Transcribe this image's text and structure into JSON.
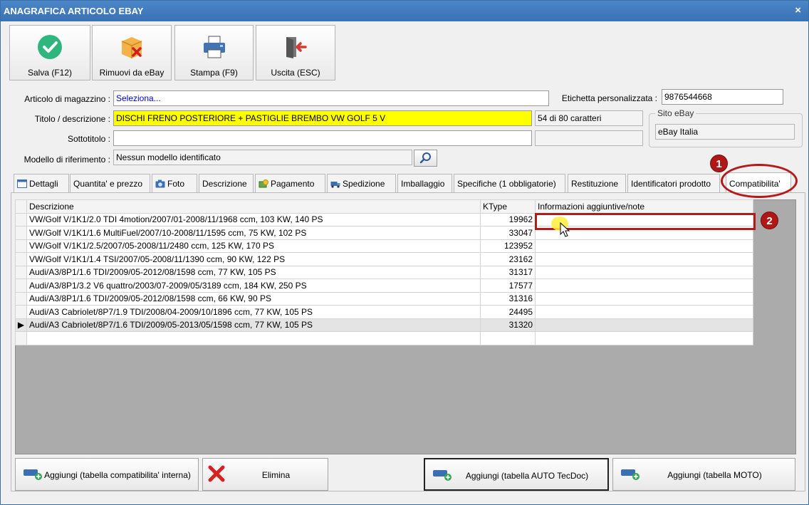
{
  "window": {
    "title": "ANAGRAFICA ARTICOLO EBAY",
    "close_glyph": "×"
  },
  "toolbar": [
    {
      "label": "Salva (F12)",
      "icon": "check-icon",
      "color": "#2eb67d"
    },
    {
      "label": "Rimuovi da eBay",
      "icon": "box-remove-icon",
      "color": "#f2a93b"
    },
    {
      "label": "Stampa (F9)",
      "icon": "printer-icon",
      "color": "#3b6fb0"
    },
    {
      "label": "Uscita (ESC)",
      "icon": "exit-icon",
      "color": "#cc3333"
    }
  ],
  "form": {
    "articolo_label": "Articolo di magazzino :",
    "articolo_value": "Seleziona...",
    "etichetta_label": "Etichetta personalizzata :",
    "etichetta_value": "9876544668",
    "titolo_label": "Titolo / descrizione :",
    "titolo_value": "DISCHI FRENO POSTERIORE + PASTIGLIE BREMBO VW GOLF 5 V",
    "titolo_count": "54 di 80 caratteri",
    "sottotitolo_label": "Sottotitolo :",
    "sottotitolo_value": "",
    "modello_label": "Modello di riferimento :",
    "modello_value": "Nessun modello identificato",
    "sito_title": "Sito eBay",
    "sito_value": "eBay Italia"
  },
  "tabs": [
    {
      "label": "Dettagli",
      "icon": "table-icon"
    },
    {
      "label": "Quantita' e prezzo",
      "icon": ""
    },
    {
      "label": "Foto",
      "icon": "camera-icon"
    },
    {
      "label": "Descrizione",
      "icon": ""
    },
    {
      "label": "Pagamento",
      "icon": "money-icon"
    },
    {
      "label": "Spedizione",
      "icon": "truck-icon"
    },
    {
      "label": "Imballaggio",
      "icon": ""
    },
    {
      "label": "Specifiche (1 obbligatorie)",
      "icon": ""
    },
    {
      "label": "Restituzione",
      "icon": ""
    },
    {
      "label": "Identificatori prodotto",
      "icon": ""
    },
    {
      "label": "Compatibilita'",
      "icon": "",
      "active": true
    }
  ],
  "grid": {
    "columns": [
      "Descrizione",
      "KType",
      "Informazioni aggiuntive/note"
    ],
    "rows": [
      {
        "descrizione": "VW/Golf V/1K1/2.0 TDI 4motion/2007/01-2008/11/1968 ccm, 103 KW, 140 PS",
        "ktype": "19962",
        "note": ""
      },
      {
        "descrizione": "VW/Golf V/1K1/1.6 MultiFuel/2007/10-2008/11/1595 ccm, 75 KW, 102 PS",
        "ktype": "33047",
        "note": ""
      },
      {
        "descrizione": "VW/Golf V/1K1/2.5/2007/05-2008/11/2480 ccm, 125 KW, 170 PS",
        "ktype": "123952",
        "note": ""
      },
      {
        "descrizione": "VW/Golf V/1K1/1.4 TSI/2007/05-2008/11/1390 ccm, 90 KW, 122 PS",
        "ktype": "23162",
        "note": ""
      },
      {
        "descrizione": "Audi/A3/8P1/1.6 TDI/2009/05-2012/08/1598 ccm, 77 KW, 105 PS",
        "ktype": "31317",
        "note": ""
      },
      {
        "descrizione": "Audi/A3/8P1/3.2 V6 quattro/2003/07-2009/05/3189 ccm, 184 KW, 250 PS",
        "ktype": "17577",
        "note": ""
      },
      {
        "descrizione": "Audi/A3/8P1/1.6 TDI/2009/05-2012/08/1598 ccm, 66 KW, 90 PS",
        "ktype": "31316",
        "note": ""
      },
      {
        "descrizione": "Audi/A3 Cabriolet/8P7/1.9 TDI/2008/04-2009/10/1896 ccm, 77 KW, 105 PS",
        "ktype": "24495",
        "note": ""
      },
      {
        "descrizione": "Audi/A3 Cabriolet/8P7/1.6 TDI/2009/05-2013/05/1598 ccm, 77 KW, 105 PS",
        "ktype": "31320",
        "note": "",
        "current": true
      }
    ],
    "row_marker": "▶"
  },
  "bottom_buttons": [
    {
      "label": "Aggiungi (tabella compatibilita' interna)",
      "icon": "car-add-icon"
    },
    {
      "label": "Elimina",
      "icon": "delete-x-icon"
    },
    {
      "label": "Aggiungi (tabella AUTO TecDoc)",
      "icon": "car-add-icon",
      "focused": true
    },
    {
      "label": "Aggiungi (tabella MOTO)",
      "icon": "car-add-icon"
    }
  ],
  "callouts": [
    "1",
    "2"
  ],
  "colors": {
    "accent_red": "#b51a1a",
    "title_blue": "#3a72b4",
    "highlight_yellow": "#ffff00"
  }
}
